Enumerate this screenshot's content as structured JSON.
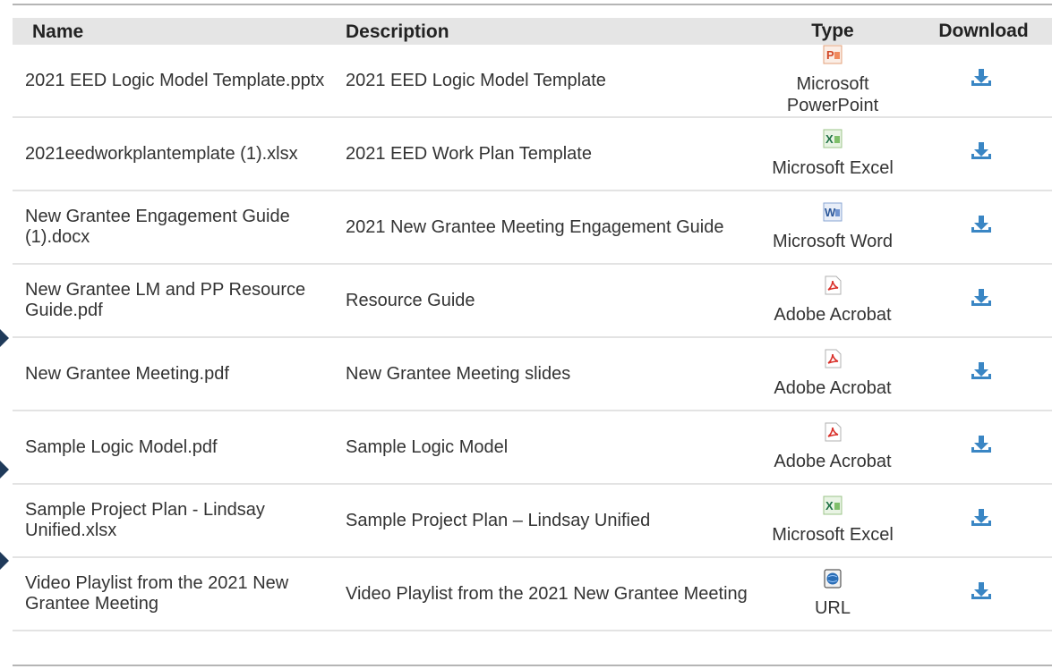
{
  "table": {
    "headers": {
      "name": "Name",
      "description": "Description",
      "type": "Type",
      "download": "Download"
    },
    "rows": [
      {
        "name": "2021 EED Logic Model Template.pptx",
        "description": "2021 EED Logic Model Template",
        "type": "Microsoft PowerPoint",
        "icon": "powerpoint-icon"
      },
      {
        "name": "2021eedworkplantemplate (1).xlsx",
        "description": "2021 EED Work Plan Template",
        "type": "Microsoft Excel",
        "icon": "excel-icon"
      },
      {
        "name": "New Grantee Engagement Guide (1).docx",
        "description": "2021 New Grantee Meeting Engagement Guide",
        "type": "Microsoft Word",
        "icon": "word-icon"
      },
      {
        "name": "New Grantee LM and PP Resource Guide.pdf",
        "description": "Resource Guide",
        "type": "Adobe Acrobat",
        "icon": "pdf-icon"
      },
      {
        "name": "New Grantee Meeting.pdf",
        "description": "New Grantee Meeting slides",
        "type": "Adobe Acrobat",
        "icon": "pdf-icon"
      },
      {
        "name": "Sample Logic Model.pdf",
        "description": "Sample Logic Model",
        "type": "Adobe Acrobat",
        "icon": "pdf-icon"
      },
      {
        "name": "Sample Project Plan - Lindsay Unified.xlsx",
        "description": "Sample Project Plan – Lindsay Unified",
        "type": "Microsoft Excel",
        "icon": "excel-icon"
      },
      {
        "name": "Video Playlist from the 2021 New Grantee Meeting",
        "description": "Video Playlist from the 2021 New Grantee Meeting",
        "type": "URL",
        "icon": "globe-icon"
      }
    ]
  },
  "colors": {
    "header_bg": "#e5e5e5",
    "download_icon": "#3a86c4",
    "marker": "#1f3a5a"
  }
}
